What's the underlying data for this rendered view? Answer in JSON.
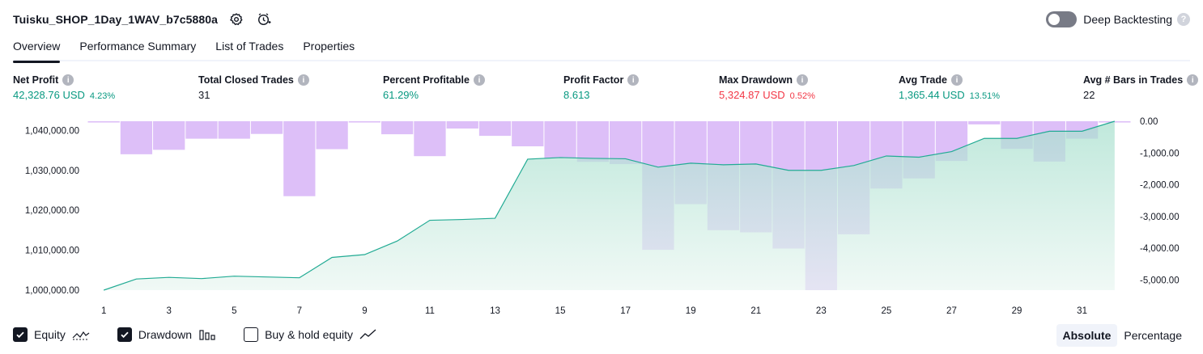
{
  "header": {
    "title": "Tuisku_SHOP_1Day_1WAV_b7c5880a",
    "deep_backtesting_label": "Deep Backtesting",
    "help_glyph": "?"
  },
  "tabs": [
    {
      "label": "Overview",
      "active": true
    },
    {
      "label": "Performance Summary",
      "active": false
    },
    {
      "label": "List of Trades",
      "active": false
    },
    {
      "label": "Properties",
      "active": false
    }
  ],
  "info_glyph": "i",
  "metrics": [
    {
      "label": "Net Profit",
      "value": "42,328.76 USD",
      "sub": "4.23%",
      "tone": "pos"
    },
    {
      "label": "Total Closed Trades",
      "value": "31",
      "sub": "",
      "tone": "neutral"
    },
    {
      "label": "Percent Profitable",
      "value": "61.29%",
      "sub": "",
      "tone": "pos"
    },
    {
      "label": "Profit Factor",
      "value": "8.613",
      "sub": "",
      "tone": "pos"
    },
    {
      "label": "Max Drawdown",
      "value": "5,324.87 USD",
      "sub": "0.52%",
      "tone": "neg"
    },
    {
      "label": "Avg Trade",
      "value": "1,365.44 USD",
      "sub": "13.51%",
      "tone": "pos"
    },
    {
      "label": "Avg # Bars in Trades",
      "value": "22",
      "sub": "",
      "tone": "neutral"
    }
  ],
  "legend": {
    "equity": {
      "label": "Equity",
      "checked": true
    },
    "drawdown": {
      "label": "Drawdown",
      "checked": true
    },
    "buy_hold": {
      "label": "Buy & hold equity",
      "checked": false
    }
  },
  "modes": [
    {
      "label": "Absolute",
      "active": true
    },
    {
      "label": "Percentage",
      "active": false
    }
  ],
  "colors": {
    "equity_line": "#22ab94",
    "equity_fill": "#b9e5d8",
    "drawdown_fill": "#d9b8f7",
    "positive": "#089981",
    "negative": "#f23645"
  },
  "chart_data": {
    "type": "area",
    "x": [
      1,
      2,
      3,
      4,
      5,
      6,
      7,
      8,
      9,
      10,
      11,
      12,
      13,
      14,
      15,
      16,
      17,
      18,
      19,
      20,
      21,
      22,
      23,
      24,
      25,
      26,
      27,
      28,
      29,
      30,
      31,
      32
    ],
    "x_ticks": [
      1,
      3,
      5,
      7,
      9,
      11,
      13,
      15,
      17,
      19,
      21,
      23,
      25,
      27,
      29,
      31
    ],
    "series": [
      {
        "name": "Equity",
        "axis": "left",
        "values": [
          1000000,
          1002800,
          1003200,
          1002900,
          1003500,
          1003300,
          1003100,
          1008200,
          1008900,
          1012300,
          1017500,
          1017700,
          1018000,
          1032800,
          1033200,
          1033000,
          1032900,
          1030800,
          1031800,
          1031400,
          1031600,
          1030000,
          1030000,
          1031200,
          1033600,
          1033300,
          1034700,
          1038000,
          1038000,
          1039800,
          1039800,
          1042300
        ]
      },
      {
        "name": "Drawdown",
        "axis": "right",
        "values": [
          -40,
          -1040,
          -900,
          -550,
          -550,
          -400,
          -2360,
          -880,
          -40,
          -410,
          -1100,
          -230,
          -460,
          -790,
          -1160,
          -1280,
          -1350,
          -4050,
          -2610,
          -3430,
          -3500,
          -4010,
          -5320,
          -3560,
          -2120,
          -1800,
          -1250,
          -100,
          -870,
          -1270,
          -550,
          -40
        ]
      }
    ],
    "y_left": {
      "ticks": [
        1000000,
        1010000,
        1020000,
        1030000,
        1040000
      ],
      "tick_labels": [
        "1,000,000.00",
        "1,010,000.00",
        "1,020,000.00",
        "1,030,000.00",
        "1,040,000.00"
      ],
      "range": [
        1000000,
        1042300
      ]
    },
    "y_right": {
      "ticks": [
        0,
        -1000,
        -2000,
        -3000,
        -4000,
        -5000
      ],
      "tick_labels": [
        "0.00",
        "-1,000.00",
        "-2,000.00",
        "-3,000.00",
        "-4,000.00",
        "-5,000.00"
      ],
      "range": [
        -5320,
        0
      ]
    },
    "grid": false
  }
}
